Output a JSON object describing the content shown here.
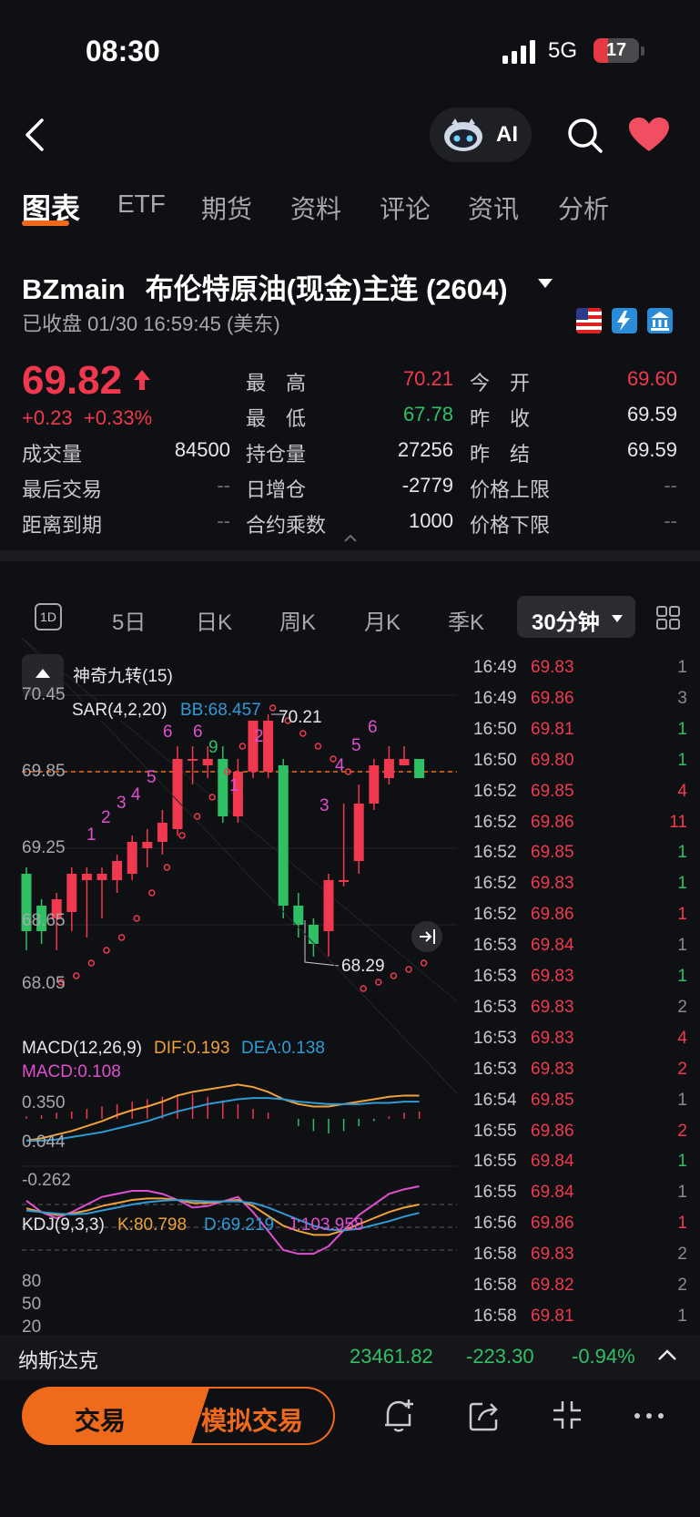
{
  "status_bar": {
    "time": "08:30",
    "network": "5G",
    "battery": "17",
    "battery_level_pct": 17
  },
  "header": {
    "ai_label": "AI"
  },
  "tabs": [
    "图表",
    "ETF",
    "期货",
    "资料",
    "评论",
    "资讯",
    "分析"
  ],
  "symbol": {
    "code": "BZmain",
    "name": "布伦特原油(现金)主连 (2604)",
    "status": "已收盘 01/30 16:59:45 (美东)"
  },
  "quote": {
    "price": "69.82",
    "change": "+0.23",
    "change_pct": "+0.33%",
    "high_label": "最　高",
    "high": "70.21",
    "low_label": "最　低",
    "low": "67.78",
    "open_label": "今　开",
    "open": "69.60",
    "prev_close_label": "昨　收",
    "prev_close": "69.59",
    "volume_label": "成交量",
    "volume": "84500",
    "oi_label": "持仓量",
    "oi": "27256",
    "prev_settle_label": "昨　结",
    "prev_settle": "69.59",
    "last_trade_label": "最后交易",
    "last_trade": "--",
    "daily_oi_label": "日增仓",
    "daily_oi": "-2779",
    "upper_limit_label": "价格上限",
    "upper_limit": "--",
    "expiry_label": "距离到期",
    "expiry": "--",
    "multiplier_label": "合约乘数",
    "multiplier": "1000",
    "lower_limit_label": "价格下限",
    "lower_limit": "--"
  },
  "periods": {
    "d1": "1D",
    "d5": "5日",
    "day": "日K",
    "week": "周K",
    "month": "月K",
    "quarter": "季K",
    "active": "30分钟"
  },
  "indicator": {
    "name": "神奇九转(15)"
  },
  "main_chart": {
    "sar_label": "SAR(4,2,20)",
    "bb_label": "BB:68.457",
    "y_ticks": [
      "70.45",
      "69.85",
      "69.25",
      "68.65",
      "68.05"
    ],
    "high_marker": "70.21",
    "low_marker": "68.29",
    "td_counts": [
      "1",
      "2",
      "3",
      "4",
      "5",
      "6",
      "6",
      "9",
      "1",
      "2",
      "3",
      "4",
      "5",
      "6"
    ]
  },
  "macd": {
    "label": "MACD(12,26,9)",
    "dif": "DIF:0.193",
    "dea": "DEA:0.138",
    "macd": "MACD:0.108",
    "y_ticks": [
      "0.350",
      "0.044",
      "-0.262"
    ]
  },
  "kdj": {
    "label": "KDJ(9,3,3)",
    "k": "K:80.798",
    "d": "D:69.219",
    "j": "J:103.958",
    "y_ticks": [
      "80",
      "50",
      "20"
    ]
  },
  "trades": [
    {
      "t": "16:49",
      "p": "69.83",
      "v": "1",
      "vc": "gray"
    },
    {
      "t": "16:49",
      "p": "69.86",
      "v": "3",
      "vc": "gray"
    },
    {
      "t": "16:50",
      "p": "69.81",
      "v": "1",
      "vc": "green"
    },
    {
      "t": "16:50",
      "p": "69.80",
      "v": "1",
      "vc": "green"
    },
    {
      "t": "16:52",
      "p": "69.85",
      "v": "4",
      "vc": "red"
    },
    {
      "t": "16:52",
      "p": "69.86",
      "v": "11",
      "vc": "red"
    },
    {
      "t": "16:52",
      "p": "69.85",
      "v": "1",
      "vc": "green"
    },
    {
      "t": "16:52",
      "p": "69.83",
      "v": "1",
      "vc": "green"
    },
    {
      "t": "16:52",
      "p": "69.86",
      "v": "1",
      "vc": "red"
    },
    {
      "t": "16:53",
      "p": "69.84",
      "v": "1",
      "vc": "gray"
    },
    {
      "t": "16:53",
      "p": "69.83",
      "v": "1",
      "vc": "green"
    },
    {
      "t": "16:53",
      "p": "69.83",
      "v": "2",
      "vc": "gray"
    },
    {
      "t": "16:53",
      "p": "69.83",
      "v": "4",
      "vc": "red"
    },
    {
      "t": "16:53",
      "p": "69.83",
      "v": "2",
      "vc": "red"
    },
    {
      "t": "16:54",
      "p": "69.85",
      "v": "1",
      "vc": "gray"
    },
    {
      "t": "16:55",
      "p": "69.86",
      "v": "2",
      "vc": "red"
    },
    {
      "t": "16:55",
      "p": "69.84",
      "v": "1",
      "vc": "green"
    },
    {
      "t": "16:55",
      "p": "69.84",
      "v": "1",
      "vc": "gray"
    },
    {
      "t": "16:56",
      "p": "69.86",
      "v": "1",
      "vc": "red"
    },
    {
      "t": "16:58",
      "p": "69.83",
      "v": "2",
      "vc": "gray"
    },
    {
      "t": "16:58",
      "p": "69.82",
      "v": "2",
      "vc": "gray"
    },
    {
      "t": "16:58",
      "p": "69.81",
      "v": "1",
      "vc": "gray"
    }
  ],
  "ticker": {
    "name": "纳斯达克",
    "value": "23461.82",
    "change": "-223.30",
    "change_pct": "-0.94%"
  },
  "bottom": {
    "trade": "交易",
    "sim_trade": "模拟交易"
  },
  "colors": {
    "up": "#f0394e",
    "down": "#2fc066",
    "accent": "#f06a1b",
    "sar": "#f0394e",
    "bb": "#2f9bd6"
  }
}
